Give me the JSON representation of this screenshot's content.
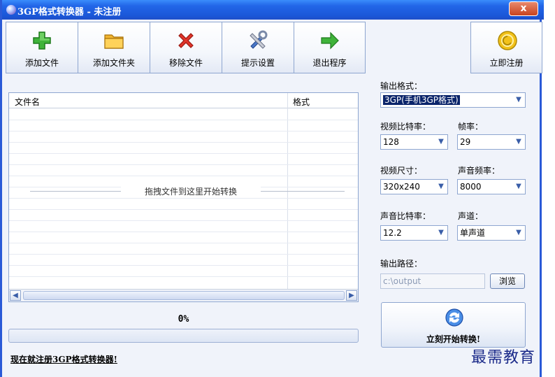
{
  "window": {
    "title": "3GP格式转换器 - 未注册",
    "close_label": "x"
  },
  "toolbar": {
    "add_file": "添加文件",
    "add_folder": "添加文件夹",
    "remove_file": "移除文件",
    "prompt_settings": "提示设置",
    "exit": "退出程序",
    "register": "立即注册"
  },
  "file_list": {
    "col_name": "文件名",
    "col_format": "格式",
    "drop_hint": "拖拽文件到这里开始转换"
  },
  "progress": {
    "percent_label": "0%",
    "value": 0
  },
  "register_link": "现在就注册3GP格式转换器!",
  "settings": {
    "output_format_label": "输出格式：",
    "output_format_value": "3GP(手机3GP格式)",
    "video_bitrate_label": "视频比特率：",
    "video_bitrate_value": "128",
    "frame_rate_label": "帧率：",
    "frame_rate_value": "29",
    "video_size_label": "视频尺寸：",
    "video_size_value": "320x240",
    "audio_freq_label": "声音频率：",
    "audio_freq_value": "8000",
    "audio_bitrate_label": "声音比特率：",
    "audio_bitrate_value": "12.2",
    "channel_label": "声道：",
    "channel_value": "单声道",
    "output_path_label": "输出路径：",
    "output_path_value": "c:\\output",
    "browse_label": "浏览"
  },
  "start_button": "立刻开始转换!",
  "watermark": "最需教育",
  "colors": {
    "titlebar": "#2266e8",
    "accent": "#0a246a",
    "progress": "#3f7fe6"
  }
}
